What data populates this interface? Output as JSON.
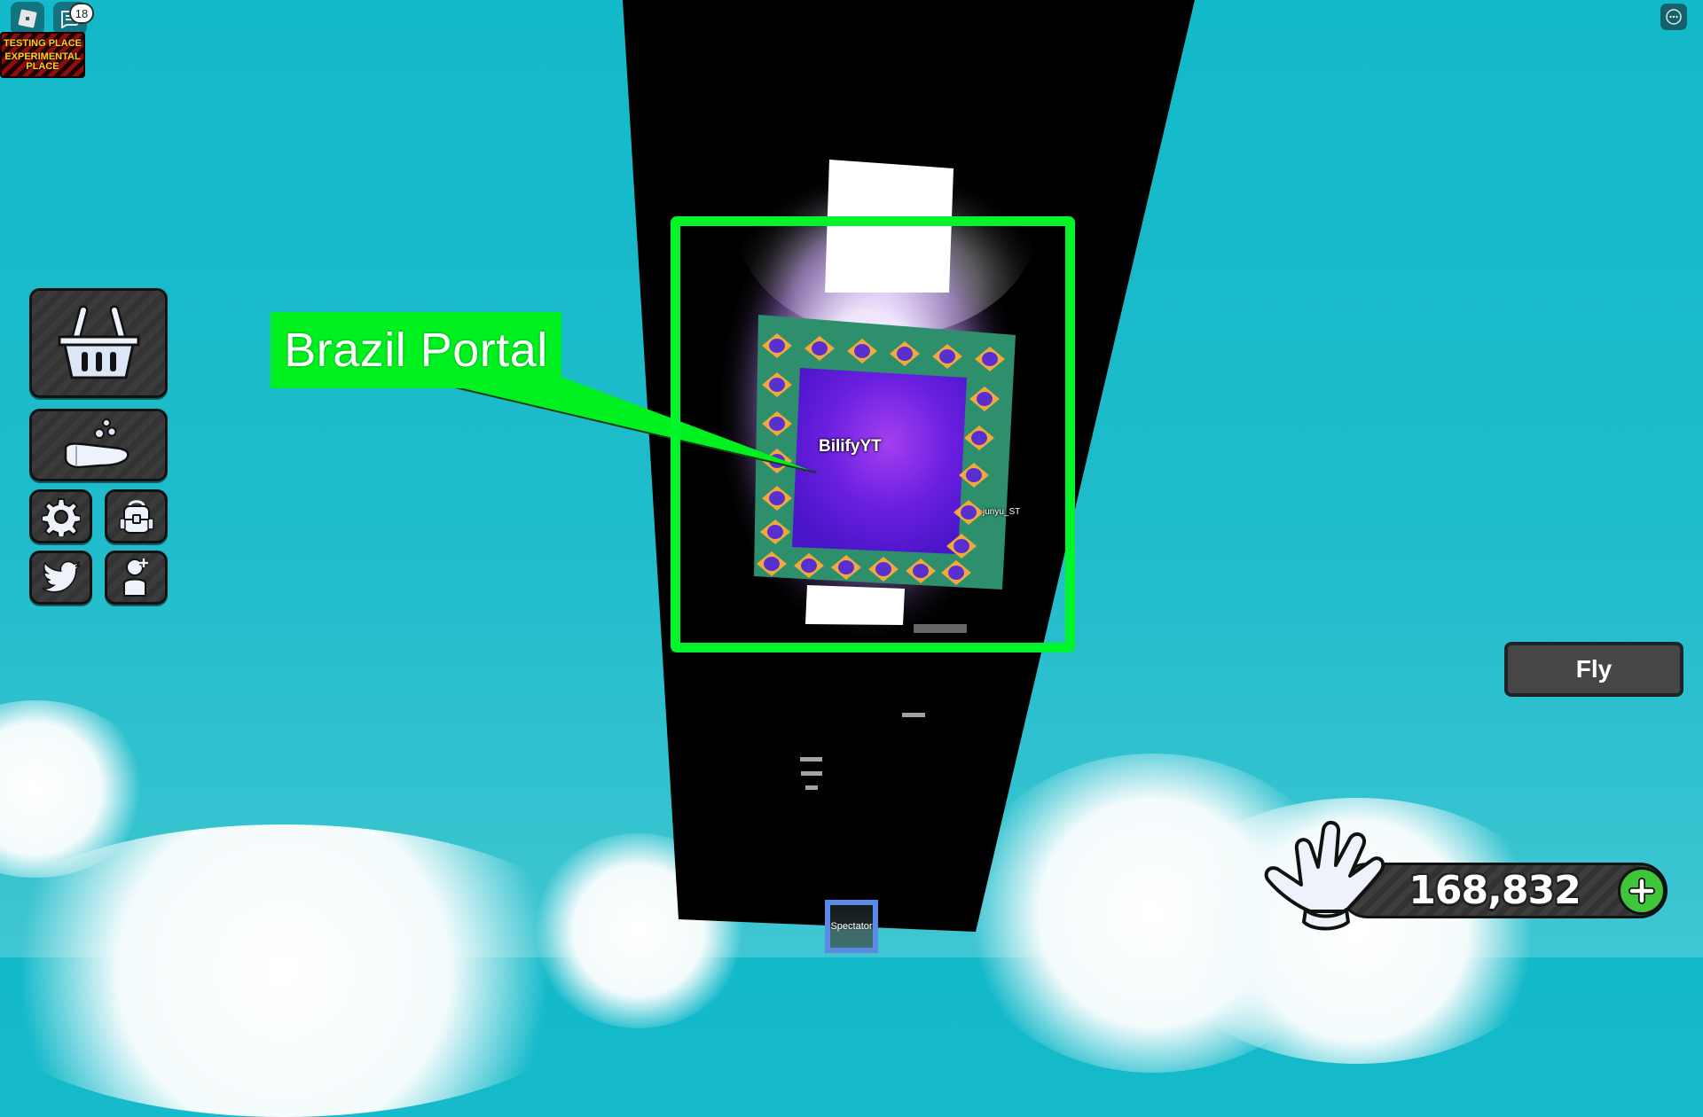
{
  "window": {
    "title": "Roblox"
  },
  "topbar": {
    "roblox_menu_icon": "roblox-logo-icon",
    "chat_icon": "chat-icon",
    "chat_unread_count": "18",
    "more_icon": "more-options-icon"
  },
  "place_sign": {
    "line1": "TESTING PLACE",
    "line2": "EXPERIMENTAL",
    "line3": "PLACE"
  },
  "side_menu": {
    "items": [
      {
        "name": "shop",
        "icon": "basket-icon"
      },
      {
        "name": "donate",
        "icon": "hand-coins-icon"
      },
      {
        "name": "settings",
        "icon": "gear-icon"
      },
      {
        "name": "inventory",
        "icon": "backpack-icon"
      },
      {
        "name": "twitter-codes",
        "icon": "twitter-bird-icon"
      },
      {
        "name": "invite-friends",
        "icon": "add-friend-icon"
      }
    ]
  },
  "annotation": {
    "label": "Brazil Portal",
    "color": "#00f11f"
  },
  "world": {
    "player_nametag": "BilifyYT",
    "other_player_nametag": "junyu_ST",
    "tiny_nametags": [
      "",
      "",
      "",
      ""
    ]
  },
  "actions": {
    "fly_label": "Fly",
    "spectator_label": "Spectator"
  },
  "currency": {
    "icon": "glove-icon",
    "value": "168,832",
    "add_icon": "plus-icon",
    "add_color": "#3fc53a"
  }
}
